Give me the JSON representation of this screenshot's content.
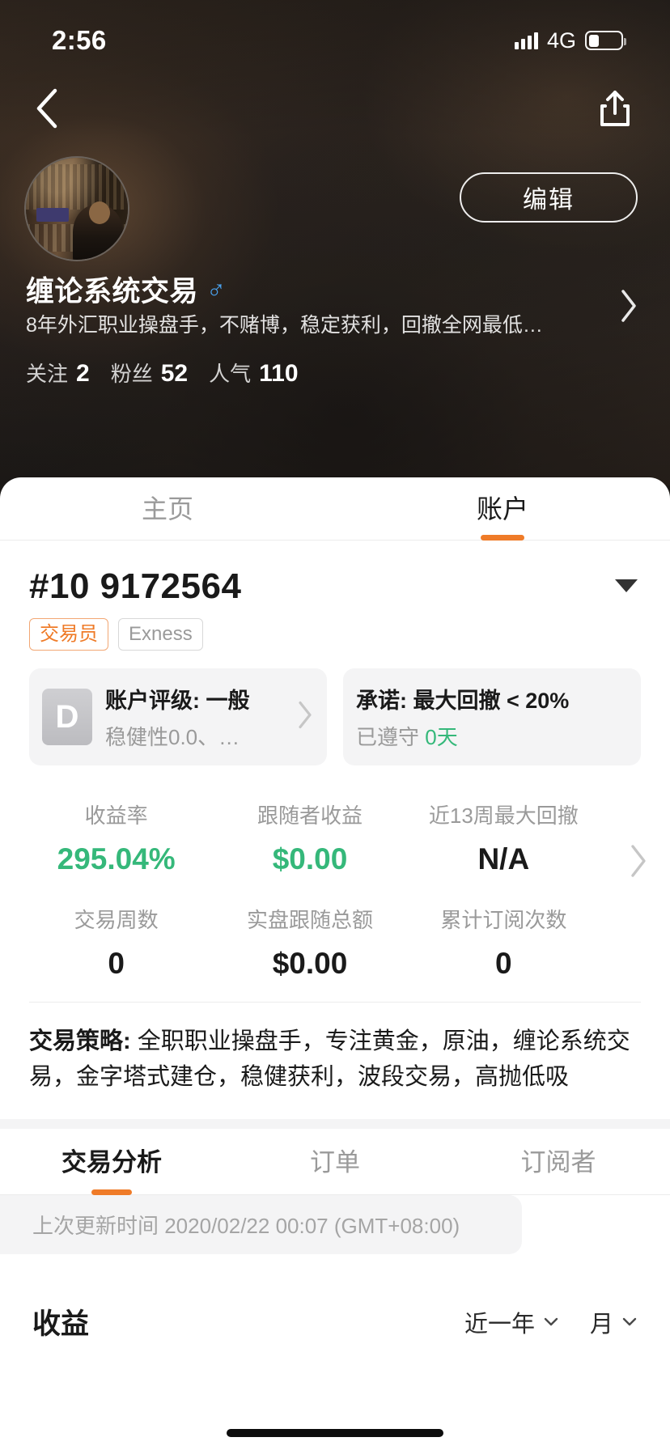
{
  "status_bar": {
    "time": "2:56",
    "network": "4G",
    "signal_icon": "signal-bars-icon",
    "battery_icon": "battery-icon"
  },
  "nav": {
    "back_icon": "back-chevron-icon",
    "share_icon": "share-icon"
  },
  "profile": {
    "avatar_alt": "avatar-photo",
    "edit_label": "编辑",
    "display_name": "缠论系统交易",
    "gender_symbol": "♂",
    "bio": "8年外汇职业操盘手，不赌博，稳定获利，回撤全网最低…",
    "chevron_icon": "chevron-right-icon",
    "counters": [
      {
        "label": "关注",
        "value": "2"
      },
      {
        "label": "粉丝",
        "value": "52"
      },
      {
        "label": "人气",
        "value": "110"
      }
    ]
  },
  "tabs": [
    {
      "label": "主页",
      "active": false
    },
    {
      "label": "账户",
      "active": true
    }
  ],
  "account": {
    "id": "#10 9172564",
    "caret_icon": "caret-down-icon",
    "badges": [
      {
        "label": "交易员",
        "style": "trader"
      },
      {
        "label": "Exness",
        "style": "broker"
      }
    ],
    "rating_card": {
      "grade": "D",
      "title": "账户评级: 一般",
      "subtitle": "稳健性0.0、…",
      "chevron_icon": "chevron-right-icon"
    },
    "promise_card": {
      "title": "承诺: 最大回撤 < 20%",
      "subtitle_prefix": "已遵守 ",
      "subtitle_value": "0天"
    }
  },
  "stats": {
    "chevron_icon": "chevron-right-icon",
    "row1": [
      {
        "label": "收益率",
        "value": "295.04%",
        "green": true
      },
      {
        "label": "跟随者收益",
        "value": "$0.00",
        "green": true
      },
      {
        "label": "近13周最大回撤",
        "value": "N/A",
        "green": false
      }
    ],
    "row2": [
      {
        "label": "交易周数",
        "value": "0",
        "green": false
      },
      {
        "label": "实盘跟随总额",
        "value": "$0.00",
        "green": false
      },
      {
        "label": "累计订阅次数",
        "value": "0",
        "green": false
      }
    ]
  },
  "strategy": {
    "label": "交易策略:",
    "text": " 全职职业操盘手，专注黄金，原油，缠论系统交易，金字塔式建仓，稳健获利，波段交易，高抛低吸"
  },
  "subtabs": [
    {
      "label": "交易分析",
      "active": true
    },
    {
      "label": "订单",
      "active": false
    },
    {
      "label": "订阅者",
      "active": false
    }
  ],
  "update_banner": "上次更新时间 2020/02/22 00:07 (GMT+08:00)",
  "earnings_section": {
    "title": "收益",
    "range_selector": "近一年",
    "period_selector": "月",
    "chevron_icon": "chevron-down-small-icon"
  },
  "colors": {
    "accent_orange": "#ef7b28",
    "green": "#35b87a",
    "muted_gray": "#9a9a9a",
    "card_gray": "#f4f4f5"
  }
}
